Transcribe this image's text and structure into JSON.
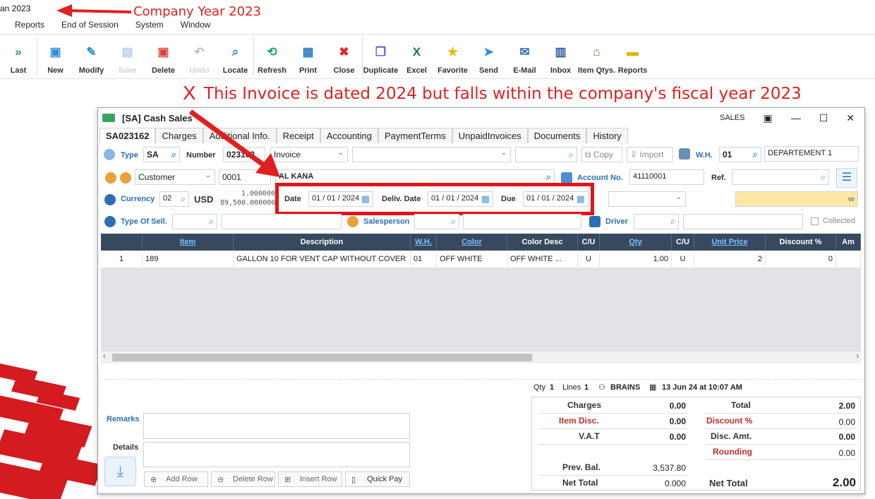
{
  "app": {
    "title": "an 2023"
  },
  "menu": [
    "Reports",
    "End of Session",
    "System",
    "Window"
  ],
  "toolbar": [
    {
      "label": "Last",
      "icon": "double-chevron-right-icon",
      "glyph": "»",
      "color": "#1aa55b"
    },
    {
      "label": "New",
      "icon": "new-doc-icon",
      "glyph": "▣",
      "color": "#2f8fd9"
    },
    {
      "label": "Modify",
      "icon": "edit-doc-icon",
      "glyph": "✎",
      "color": "#2f8fd9"
    },
    {
      "label": "Save",
      "icon": "save-icon",
      "glyph": "▤",
      "color": "#7aa6cf"
    },
    {
      "label": "Delete",
      "icon": "delete-doc-icon",
      "glyph": "▣",
      "color": "#d9443a"
    },
    {
      "label": "Undo",
      "icon": "undo-icon",
      "glyph": "↶",
      "color": "#8a7ac0"
    },
    {
      "label": "Locate",
      "icon": "search-icon",
      "glyph": "⌕",
      "color": "#2f8fd9"
    },
    {
      "label": "Refresh",
      "icon": "refresh-icon",
      "glyph": "⟲",
      "color": "#1aa55b"
    },
    {
      "label": "Print",
      "icon": "print-icon",
      "glyph": "▦",
      "color": "#2f7fc9"
    },
    {
      "label": "Close",
      "icon": "close-icon",
      "glyph": "✖",
      "color": "#e0262b"
    },
    {
      "label": "Duplicate",
      "icon": "duplicate-icon",
      "glyph": "❐",
      "color": "#6b5bd0"
    },
    {
      "label": "Excel",
      "icon": "excel-icon",
      "glyph": "X",
      "color": "#1f7a3d"
    },
    {
      "label": "Favorite",
      "icon": "star-icon",
      "glyph": "★",
      "color": "#f2b400"
    },
    {
      "label": "Send",
      "icon": "send-icon",
      "glyph": "➤",
      "color": "#2f8fd9"
    },
    {
      "label": "E-Mail",
      "icon": "mail-icon",
      "glyph": "✉",
      "color": "#2f6fb9"
    },
    {
      "label": "Inbox",
      "icon": "inbox-icon",
      "glyph": "▥",
      "color": "#2f5fa0"
    },
    {
      "label": "Item Qtys.",
      "icon": "warehouse-icon",
      "glyph": "⌂",
      "color": "#8a5a2b"
    },
    {
      "label": "Reports",
      "icon": "folder-icon",
      "glyph": "▬",
      "color": "#e3b400"
    }
  ],
  "annotations": {
    "company": "Company Year 2023",
    "x_mark": "X",
    "invoice": "This Invoice is dated 2024 but falls within the company's fiscal year 2023"
  },
  "window": {
    "title": "[SA] Cash Sales",
    "right_label": "SALES",
    "tabs": [
      "SA023162",
      "Charges",
      "Additional Info.",
      "Receipt",
      "Accounting",
      "PaymentTerms",
      "UnpaidInvoices",
      "Documents",
      "History"
    ]
  },
  "form": {
    "type_label": "Type",
    "type_value": "SA",
    "number_label": "Number",
    "number_value": "023162",
    "doc_type": "Invoice",
    "copy_label": "Copy",
    "import_label": "Import",
    "wh_label": "W.H.",
    "wh_value": "01",
    "wh_name": "DEPARTEMENT 1",
    "customer_type": "Customer",
    "customer_code": "0001",
    "customer_name": "AL KANA",
    "account_label": "Account No.",
    "account_value": "41110001",
    "ref_label": "Ref.",
    "currency_label": "Currency",
    "currency_code": "02",
    "currency_name": "USD",
    "rate1": "1.000000",
    "rate2": "89,500.000000",
    "date_label": "Date",
    "date_value": "01 / 01 / 2024",
    "deliv_label": "Deliv. Date",
    "deliv_value": "01 / 01 / 2024",
    "due_label": "Due",
    "due_value": "01 / 01 / 2024",
    "type_sell_label": "Type Of Sell.",
    "salesperson_label": "Salesperson",
    "driver_label": "Driver",
    "collected_label": "Collected"
  },
  "grid": {
    "columns": [
      "",
      "Item",
      "Description",
      "W.H.",
      "Color",
      "Color Desc",
      "C/U",
      "Qty",
      "C/U",
      "Unit Price",
      "Discount %",
      "Am"
    ],
    "rows": [
      [
        "1",
        "189",
        "GALLON 10 FOR VENT CAP WITHOUT COVER",
        "01",
        "OFF WHITE",
        "OFF WHITE      ...",
        "U",
        "1.00",
        "U",
        "2",
        "0",
        ""
      ]
    ]
  },
  "status": {
    "qty_label": "Qty",
    "qty_value": "1",
    "lines_label": "Lines",
    "lines_value": "1",
    "user": "BRAINS",
    "datetime": "13 Jun 24 at 10:07 AM"
  },
  "bottom": {
    "remarks_label": "Remarks",
    "details_label": "Details",
    "add_row": "Add Row",
    "delete_row": "Delete Row",
    "insert_row": "Insert Row",
    "quick_pay": "Quick Pay"
  },
  "totals": {
    "charges_label": "Charges",
    "charges_value": "0.00",
    "item_disc_label": "Item Disc.",
    "item_disc_value": "0.00",
    "vat_label": "V.A.T",
    "vat_value": "0.00",
    "prev_bal_label": "Prev. Bal.",
    "prev_bal_value": "3,537.80",
    "net_total_left_label": "Net Total",
    "net_total_left_value": "0.000",
    "total_label": "Total",
    "total_value": "2.00",
    "discount_pct_label": "Discount %",
    "discount_pct_value": "0.00",
    "disc_amt_label": "Disc. Amt.",
    "disc_amt_value": "0.00",
    "rounding_label": "Rounding",
    "rounding_value": "0.00",
    "net_total_label": "Net Total",
    "net_total_value": "2.00"
  }
}
